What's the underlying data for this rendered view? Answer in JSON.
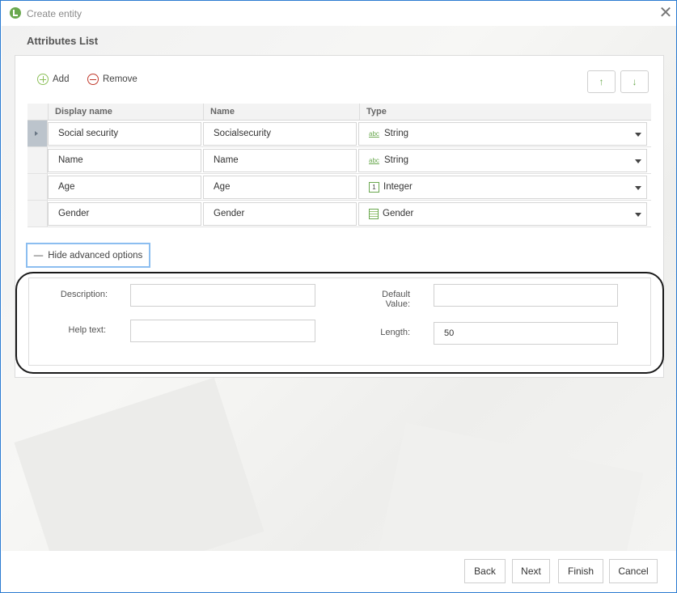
{
  "window": {
    "title": "Create entity"
  },
  "section": {
    "title": "Attributes List"
  },
  "toolbar": {
    "add_label": "Add",
    "remove_label": "Remove",
    "up_label": "↑",
    "down_label": "↓"
  },
  "grid": {
    "columns": [
      "Display name",
      "Name",
      "Type"
    ],
    "rows": [
      {
        "display": "Social security",
        "name": "Socialsecurity",
        "type": "String",
        "type_icon": "abc-string-icon",
        "selected": true
      },
      {
        "display": "Name",
        "name": "Name",
        "type": "String",
        "type_icon": "abc-string-icon",
        "selected": false
      },
      {
        "display": "Age",
        "name": "Age",
        "type": "Integer",
        "type_icon": "integer-icon",
        "selected": false
      },
      {
        "display": "Gender",
        "name": "Gender",
        "type": "Gender",
        "type_icon": "table-icon",
        "selected": false
      }
    ]
  },
  "advanced": {
    "toggle_label": "Hide advanced options",
    "toggle_icon": "—",
    "description_label": "Description:",
    "description_value": "",
    "help_label": "Help text:",
    "help_value": "",
    "default_label_line1": "Default",
    "default_label_line2": "Value:",
    "default_value": "",
    "length_label": "Length:",
    "length_value": "50"
  },
  "footer": {
    "back": "Back",
    "next": "Next",
    "finish": "Finish",
    "cancel": "Cancel"
  },
  "colors": {
    "accent_green": "#6aa84f",
    "remove_red": "#c0392b",
    "focus_blue": "#8cbef0"
  }
}
